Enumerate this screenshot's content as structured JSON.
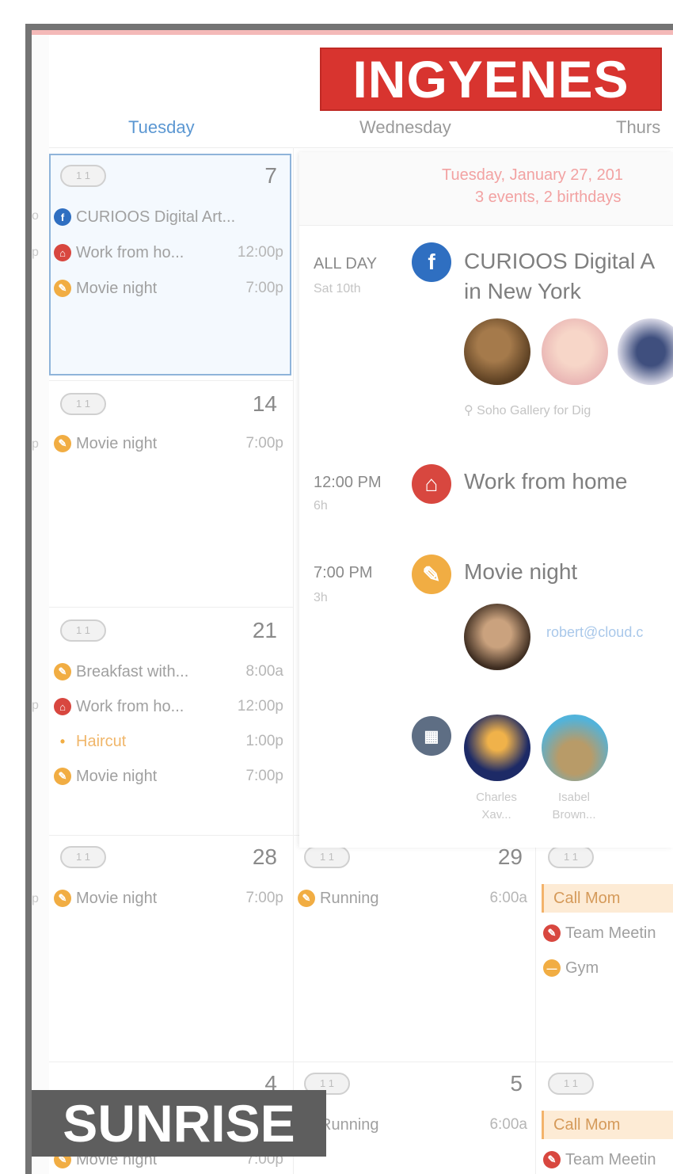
{
  "banner_top": "INGYENES",
  "banner_bottom": "SUNRISE",
  "day_headers": [
    "Tuesday",
    "Wednesday",
    "Thurs"
  ],
  "week_pills": [
    "1 1",
    "1 1",
    "1 1",
    "1 1",
    "1 1",
    "1 1",
    "1 1"
  ],
  "weeks": [
    {
      "day": "7",
      "events": [
        {
          "name": "CURIOOS Digital Art...",
          "time": "",
          "color": "#2f6fc1",
          "glyph": "f"
        },
        {
          "name": "Work from ho...",
          "time": "12:00p",
          "color": "#d8473f",
          "glyph": "⌂"
        },
        {
          "name": "Movie night",
          "time": "7:00p",
          "color": "#f1ad43",
          "glyph": "✎"
        }
      ]
    },
    {
      "day": "14",
      "events": [
        {
          "name": "Movie night",
          "time": "7:00p",
          "color": "#f1ad43",
          "glyph": "✎"
        }
      ]
    },
    {
      "day": "21",
      "events": [
        {
          "name": "Breakfast with...",
          "time": "8:00a",
          "color": "#f1ad43",
          "glyph": "✎"
        },
        {
          "name": "Work from ho...",
          "time": "12:00p",
          "color": "#d8473f",
          "glyph": "⌂"
        },
        {
          "name": "Haircut",
          "time": "1:00p",
          "color": "#f1ad43",
          "glyph": "•"
        },
        {
          "name": "Movie night",
          "time": "7:00p",
          "color": "#f1ad43",
          "glyph": "✎"
        }
      ]
    },
    {
      "day": "28",
      "events": [
        {
          "name": "Movie night",
          "time": "7:00p",
          "color": "#f1ad43",
          "glyph": "✎"
        }
      ]
    }
  ],
  "wed_28": {
    "day": "29",
    "events": [
      {
        "name": "Running",
        "time": "6:00a"
      }
    ]
  },
  "wed_next": {
    "day": "5",
    "events": [
      {
        "name": "Running",
        "time": "6:00a"
      }
    ]
  },
  "tue_next": {
    "day": "4",
    "events": [
      {
        "name": "Movie night",
        "time": "7:00p"
      }
    ]
  },
  "thu_29": [
    "Call Mom",
    "Team Meetin",
    "Gym"
  ],
  "thu_next": [
    "Call Mom",
    "Team Meetin"
  ],
  "detail": {
    "date_line": "Tuesday, January 27, 201",
    "count_line": "3 events, 2 birthdays",
    "items": [
      {
        "time": "ALL DAY",
        "sub": "Sat 10th",
        "title": "CURIOOS Digital A",
        "title2": "in New York",
        "location": "Soho Gallery for Dig",
        "icon": "f",
        "color": "#2f6fc1"
      },
      {
        "time": "12:00 PM",
        "sub": "6h",
        "title": "Work from home",
        "icon": "⌂",
        "color": "#d8473f"
      },
      {
        "time": "7:00 PM",
        "sub": "3h",
        "title": "Movie night",
        "email": "robert@cloud.c",
        "icon": "✎",
        "color": "#f1ad43"
      }
    ],
    "birthday_names": [
      "Charles Xav...",
      "Isabel Brown..."
    ]
  }
}
